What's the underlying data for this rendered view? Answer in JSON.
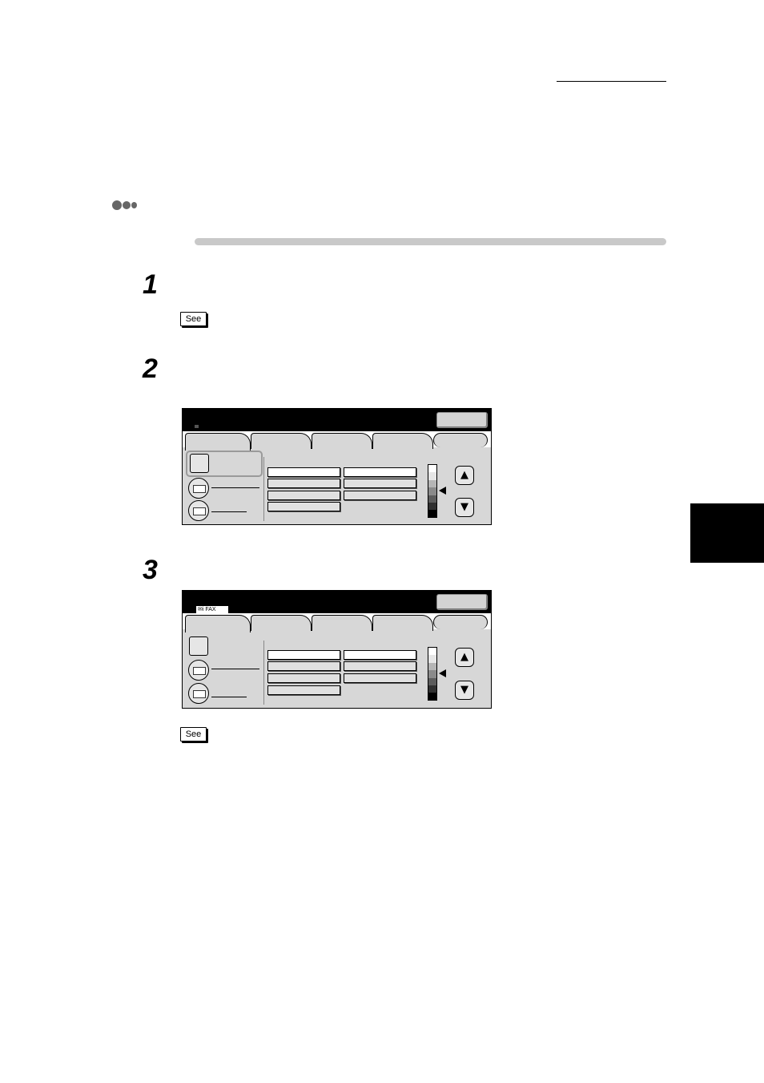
{
  "steps": [
    {
      "number": "1",
      "see_label": "See"
    },
    {
      "number": "2"
    },
    {
      "number": "3",
      "see_label": "See"
    }
  ],
  "screen_3": {
    "ifax_label": "✉i FAX"
  },
  "icons": {
    "section_marker": "three-dot-section-icon",
    "up": "up-arrow-icon",
    "down": "down-arrow-icon",
    "envelope": "envelope-icon"
  },
  "colors": {
    "chapter_tab": "#000000",
    "section_bar": "#c9c9c9",
    "panel_body": "#d7d7d7"
  },
  "arrows": {
    "up": "▲",
    "down": "▼"
  }
}
